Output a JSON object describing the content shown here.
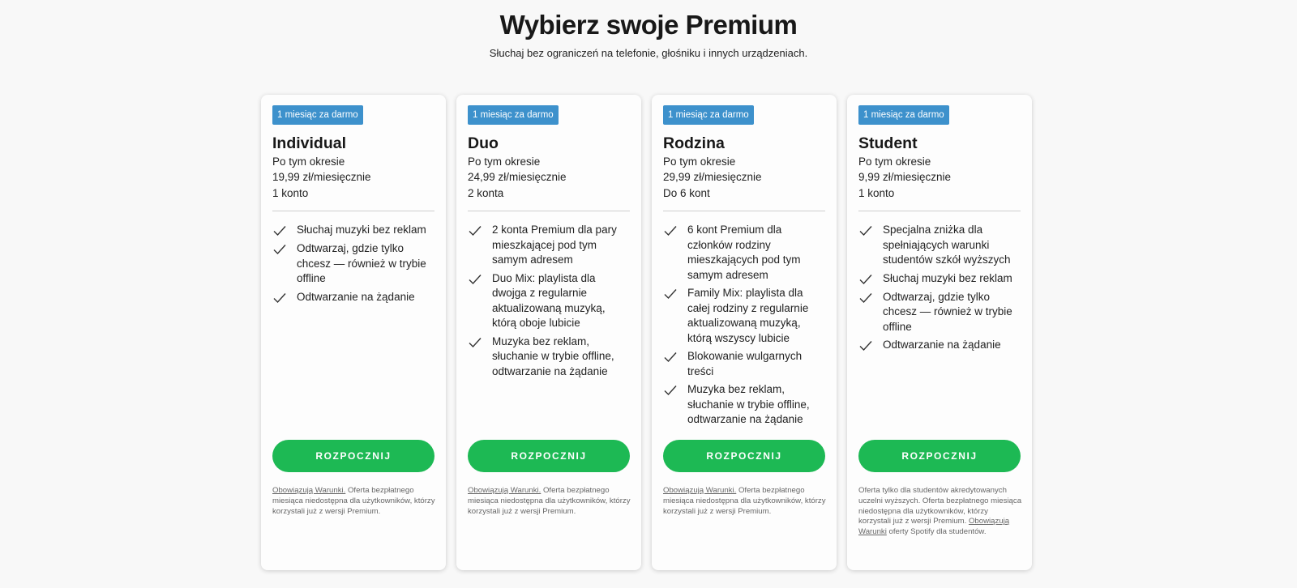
{
  "header": {
    "title": "Wybierz swoje Premium",
    "subtitle": "Słuchaj bez ograniczeń na telefonie, głośniku i innych urządzeniach."
  },
  "colors": {
    "badge": "#3d91cc",
    "cta": "#1db954",
    "background": "#f8f8f8"
  },
  "plans": [
    {
      "badge": "1 miesiąc za darmo",
      "name": "Individual",
      "after": "Po tym okresie",
      "price": "19,99 zł/miesięcznie",
      "accounts": "1 konto",
      "features": [
        "Słuchaj muzyki bez reklam",
        "Odtwarzaj, gdzie tylko chcesz — również w trybie offline",
        "Odtwarzanie na żądanie"
      ],
      "cta": "ROZPOCZNIJ",
      "terms_link": "Obowiązują Warunki.",
      "fine_print": " Oferta bezpłatnego miesiąca niedostępna dla użytkowników, którzy korzystali już z wersji Premium."
    },
    {
      "badge": "1 miesiąc za darmo",
      "name": "Duo",
      "after": "Po tym okresie",
      "price": "24,99 zł/miesięcznie",
      "accounts": "2 konta",
      "features": [
        "2 konta Premium dla pary mieszkającej pod tym samym adresem",
        "Duo Mix: playlista dla dwojga z regularnie aktualizowaną muzyką, którą oboje lubicie",
        "Muzyka bez reklam, słuchanie w trybie offline, odtwarzanie na żądanie"
      ],
      "cta": "ROZPOCZNIJ",
      "terms_link": "Obowiązują Warunki.",
      "fine_print": " Oferta bezpłatnego miesiąca niedostępna dla użytkowników, którzy korzystali już z wersji Premium."
    },
    {
      "badge": "1 miesiąc za darmo",
      "name": "Rodzina",
      "after": "Po tym okresie",
      "price": "29,99 zł/miesięcznie",
      "accounts": "Do 6 kont",
      "features": [
        "6 kont Premium dla członków rodziny mieszkających pod tym samym adresem",
        "Family Mix: playlista dla całej rodziny z regularnie aktualizowaną muzyką, którą wszyscy lubicie",
        "Blokowanie wulgarnych treści",
        "Muzyka bez reklam, słuchanie w trybie offline, odtwarzanie na żądanie"
      ],
      "cta": "ROZPOCZNIJ",
      "terms_link": "Obowiązują Warunki.",
      "fine_print": " Oferta bezpłatnego miesiąca niedostępna dla użytkowników, którzy korzystali już z wersji Premium."
    },
    {
      "badge": "1 miesiąc za darmo",
      "name": "Student",
      "after": "Po tym okresie",
      "price": "9,99 zł/miesięcznie",
      "accounts": "1 konto",
      "features": [
        "Specjalna zniżka dla spełniających warunki studentów szkół wyższych",
        "Słuchaj muzyki bez reklam",
        "Odtwarzaj, gdzie tylko chcesz — również w trybie offline",
        "Odtwarzanie na żądanie"
      ],
      "cta": "ROZPOCZNIJ",
      "fine_print_pre": "Oferta tylko dla studentów akredytowanych uczelni wyższych. Oferta bezpłatnego miesiąca niedostępna dla użytkowników, którzy korzystali już z wersji Premium. ",
      "terms_link": "Obowiązują Warunki",
      "fine_print": " oferty Spotify dla studentów."
    }
  ]
}
